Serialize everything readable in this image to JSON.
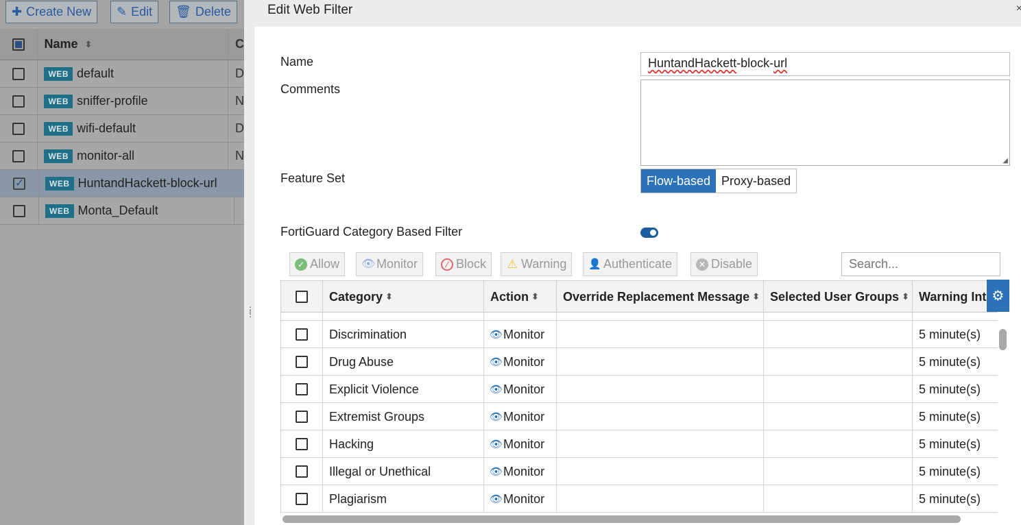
{
  "background": {
    "toolbar": {
      "create_new": "Create New",
      "edit": "Edit",
      "delete": "Delete"
    },
    "table": {
      "header_name": "Name",
      "header_next": "C",
      "rows": [
        {
          "badge": "WEB",
          "name": "default",
          "next": "D",
          "checked": false
        },
        {
          "badge": "WEB",
          "name": "sniffer-profile",
          "next": "N",
          "checked": false
        },
        {
          "badge": "WEB",
          "name": "wifi-default",
          "next": "D",
          "checked": false
        },
        {
          "badge": "WEB",
          "name": "monitor-all",
          "next": "N",
          "checked": false
        },
        {
          "badge": "WEB",
          "name": "HuntandHackett-block-url",
          "next": "",
          "checked": true
        },
        {
          "badge": "WEB",
          "name": "Monta_Default",
          "next": "",
          "checked": false
        }
      ]
    }
  },
  "panel": {
    "title": "Edit Web Filter",
    "close": "×",
    "form": {
      "name_label": "Name",
      "name_value_part1": "HuntandHackett",
      "name_value_part2": "-block-",
      "name_value_part3": "url",
      "comments_label": "Comments",
      "feature_set_label": "Feature Set",
      "feature_set_options": [
        "Flow-based",
        "Proxy-based"
      ],
      "feature_set_selected": "Flow-based",
      "fortiguard_label": "FortiGuard Category Based Filter",
      "fortiguard_enabled": true
    },
    "actions": {
      "allow": "Allow",
      "monitor": "Monitor",
      "block": "Block",
      "warning": "Warning",
      "authenticate": "Authenticate",
      "disable": "Disable"
    },
    "search_placeholder": "Search...",
    "category_table": {
      "headers": {
        "category": "Category",
        "action": "Action",
        "override": "Override Replacement Message",
        "user_groups": "Selected User Groups",
        "warning_interval": "Warning Inte"
      },
      "rows": [
        {
          "category": "Discrimination",
          "action": "Monitor",
          "override": "",
          "groups": "",
          "interval": "5 minute(s)"
        },
        {
          "category": "Drug Abuse",
          "action": "Monitor",
          "override": "",
          "groups": "",
          "interval": "5 minute(s)"
        },
        {
          "category": "Explicit Violence",
          "action": "Monitor",
          "override": "",
          "groups": "",
          "interval": "5 minute(s)"
        },
        {
          "category": "Extremist Groups",
          "action": "Monitor",
          "override": "",
          "groups": "",
          "interval": "5 minute(s)"
        },
        {
          "category": "Hacking",
          "action": "Monitor",
          "override": "",
          "groups": "",
          "interval": "5 minute(s)"
        },
        {
          "category": "Illegal or Unethical",
          "action": "Monitor",
          "override": "",
          "groups": "",
          "interval": "5 minute(s)"
        },
        {
          "category": "Plagiarism",
          "action": "Monitor",
          "override": "",
          "groups": "",
          "interval": "5 minute(s)"
        }
      ]
    }
  },
  "colors": {
    "accent": "#2b72b9",
    "badge": "#1f6f87",
    "overlay": "#a7a7a7"
  }
}
